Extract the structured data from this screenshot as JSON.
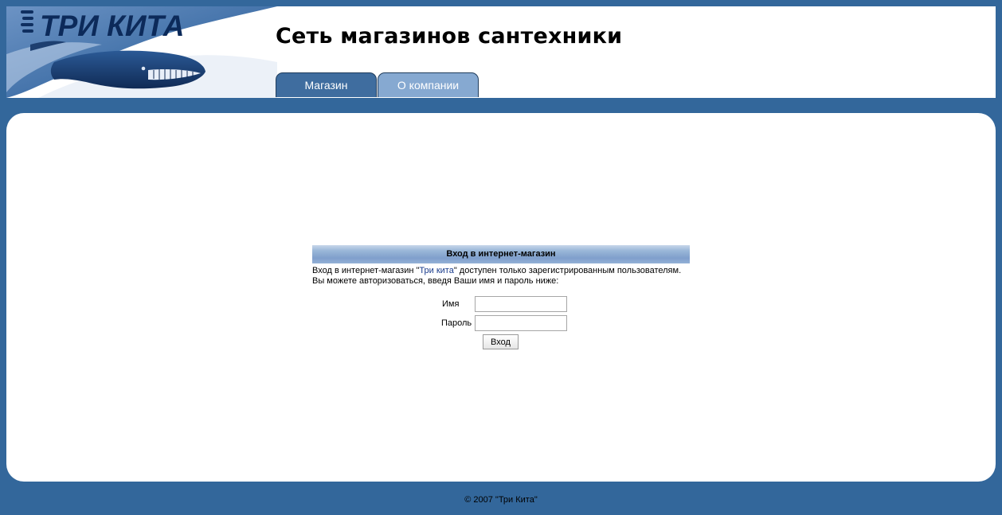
{
  "header": {
    "logo_text": "ТРИ КИТА",
    "site_title": "Сеть магазинов сантехники",
    "tabs": [
      {
        "label": "Магазин",
        "active": true
      },
      {
        "label": "О компании",
        "active": false
      }
    ]
  },
  "login": {
    "heading": "Вход в интернет-магазин",
    "desc_part1": "Вход в интернет-магазин \"",
    "desc_link": "Три кита",
    "desc_part2": "\" доступен только зарегистрированным пользователям.",
    "desc_line2": "Вы можете авторизоваться, введя Ваши имя и пароль ниже:",
    "name_label": "Имя",
    "name_value": "",
    "password_label": "Пароль",
    "password_value": "",
    "submit_label": "Вход"
  },
  "footer": {
    "copyright": "© 2007 \"Три Кита\""
  },
  "colors": {
    "background": "#33679b",
    "tab_active": "#3f6d9f",
    "tab_inactive": "#86a9d1",
    "link": "#1a3c8c"
  }
}
